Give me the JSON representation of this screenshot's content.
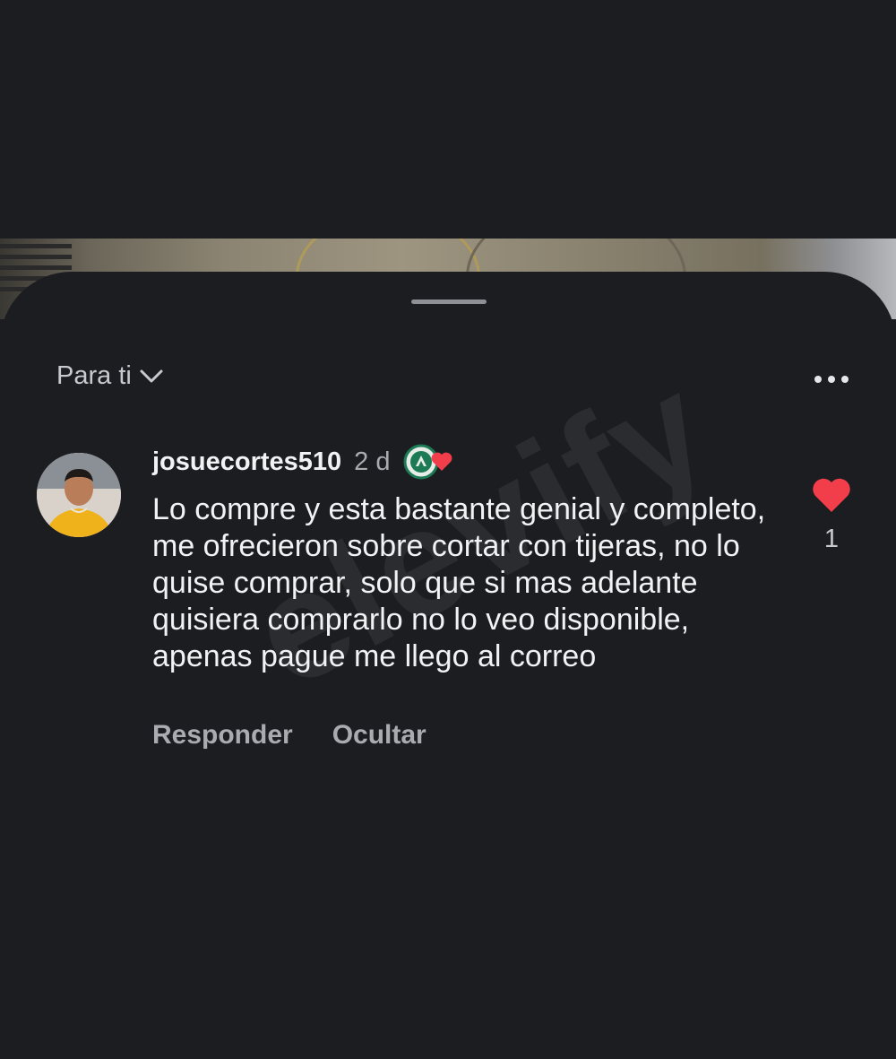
{
  "sheet": {
    "filter_label": "Para ti",
    "more_icon": "more-horizontal-icon"
  },
  "comment": {
    "username": "josuecortes510",
    "time": "2 d",
    "text": "Lo compre y esta bastante genial y completo, me ofrecieron sobre cortar con tijeras, no lo quise comprar, solo que si mas adelante quisiera comprarlo no lo veo disponible, apenas pague me llego al correo",
    "like_count": "1",
    "like_color": "#f23d4a",
    "reply_label": "Responder",
    "hide_label": "Ocultar"
  },
  "watermark": "elevify"
}
